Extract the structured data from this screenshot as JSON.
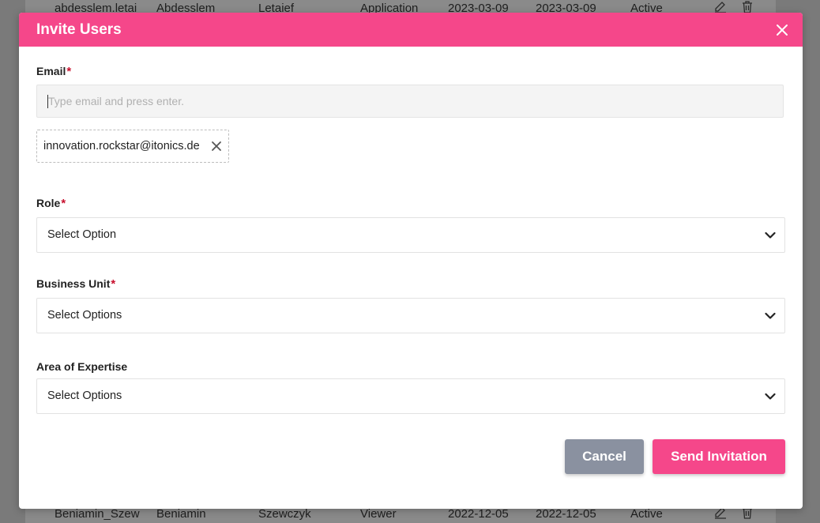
{
  "background_table": {
    "top_row": [
      "abdesslem.letai",
      "Abdesslem",
      "Letaief",
      "Application",
      "2023-03-09",
      "2023-03-09",
      "Active"
    ],
    "bottom_row": [
      "Beniamin_Szew",
      "Beniamin",
      "Szewczyk",
      "Viewer",
      "2022-12-05",
      "2022-12-05",
      "Active"
    ],
    "action_icons": [
      "edit-icon",
      "trash-icon"
    ]
  },
  "modal": {
    "title": "Invite Users",
    "close_icon": "close-icon",
    "colors": {
      "header": "#f5478a",
      "required": "#c8102e",
      "cancel": "#8a91a0",
      "send": "#f5478a"
    },
    "email": {
      "label": "Email",
      "required_mark": "*",
      "placeholder": "Type email and press enter.",
      "value": "",
      "chips": [
        "innovation.rockstar@itonics.de"
      ]
    },
    "role": {
      "label": "Role",
      "required_mark": "*",
      "value": "Select Option"
    },
    "business_unit": {
      "label": "Business Unit",
      "required_mark": "*",
      "value": "Select Options"
    },
    "area_of_expertise": {
      "label": "Area of Expertise",
      "value": "Select Options"
    },
    "buttons": {
      "cancel": "Cancel",
      "send": "Send Invitation"
    }
  }
}
